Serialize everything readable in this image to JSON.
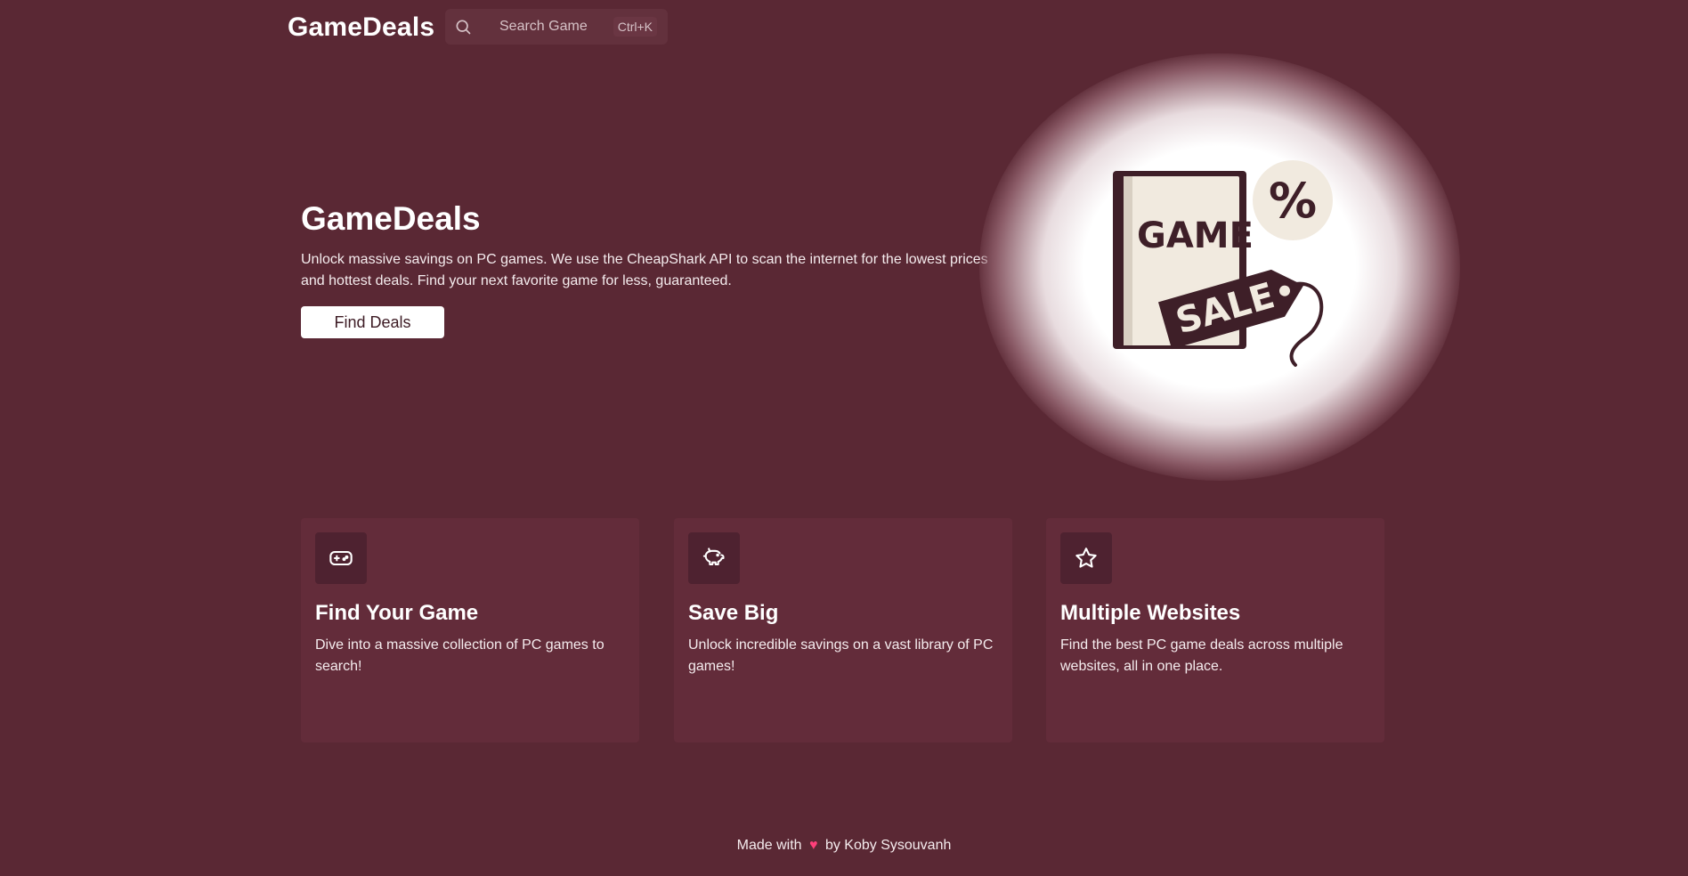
{
  "header": {
    "brand": "GameDeals",
    "search": {
      "placeholder": "Search Game",
      "shortcut": "Ctrl+K"
    }
  },
  "hero": {
    "title": "GameDeals",
    "description": "Unlock massive savings on PC games. We use the CheapShark API to scan the internet for the lowest prices and hottest deals. Find your next favorite game for less, guaranteed.",
    "cta_label": "Find Deals",
    "art": {
      "game_text": "GAME",
      "sale_text": "SALE",
      "percent_text": "%"
    }
  },
  "features": [
    {
      "icon": "gamepad-icon",
      "title": "Find Your Game",
      "description": "Dive into a massive collection of PC games to search!"
    },
    {
      "icon": "piggy-bank-icon",
      "title": "Save Big",
      "description": "Unlock incredible savings on a vast library of PC games!"
    },
    {
      "icon": "star-icon",
      "title": "Multiple Websites",
      "description": "Find the best PC game deals across multiple websites, all in one place."
    }
  ],
  "footer": {
    "made_with": "Made with",
    "heart": "♥",
    "by": "by Koby Sysouvanh"
  },
  "colors": {
    "background": "#5a2834",
    "card": "#632c3a",
    "icon_tile": "#4e2230",
    "heart": "#ff3f7a"
  }
}
